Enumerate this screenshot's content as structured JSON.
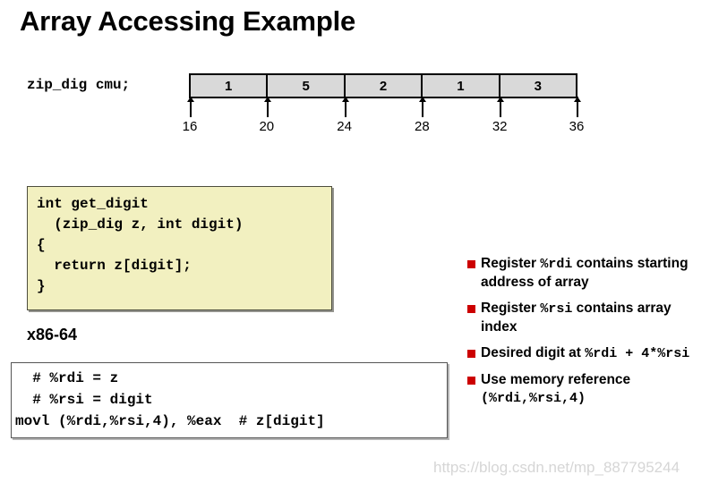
{
  "slide": {
    "title": "Array Accessing Example"
  },
  "array_diagram": {
    "declaration": "zip_dig cmu;",
    "cells": [
      "1",
      "5",
      "2",
      "1",
      "3"
    ],
    "tick_labels": [
      "16",
      "20",
      "24",
      "28",
      "32",
      "36"
    ],
    "cell_fill_color": "#d9d9d9",
    "border_color": "#000000"
  },
  "c_code": {
    "language_label": "",
    "background_color": "#f2f0c0",
    "text": "int get_digit\n  (zip_dig z, int digit)\n{\n  return z[digit];\n}"
  },
  "assembly": {
    "label": "x86-64",
    "text": "  # %rdi = z\n  # %rsi = digit\nmovl (%rdi,%rsi,4), %eax  # z[digit]"
  },
  "bullets": {
    "marker_color": "#cc0000",
    "items": [
      {
        "parts": [
          {
            "text": "Register ",
            "mono": false
          },
          {
            "text": "%rdi",
            "mono": true
          },
          {
            "text": " contains starting address of array",
            "mono": false
          }
        ]
      },
      {
        "parts": [
          {
            "text": "Register ",
            "mono": false
          },
          {
            "text": "%rsi",
            "mono": true
          },
          {
            "text": " contains array index",
            "mono": false
          }
        ]
      },
      {
        "parts": [
          {
            "text": "Desired digit at ",
            "mono": false
          },
          {
            "text": "%rdi + 4*%rsi",
            "mono": true
          }
        ]
      },
      {
        "parts": [
          {
            "text": "Use memory reference ",
            "mono": false
          },
          {
            "text": "(%rdi,%rsi,4)",
            "mono": true
          }
        ]
      }
    ]
  },
  "watermark": {
    "text": "https://blog.csdn.net/mp_887795244"
  }
}
